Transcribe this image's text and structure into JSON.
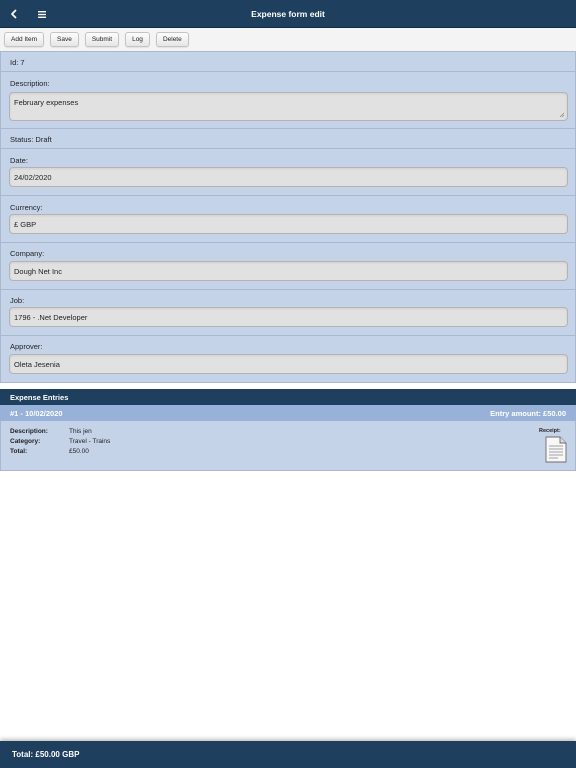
{
  "header": {
    "title": "Expense form edit",
    "back_icon": "chevron-left-icon",
    "menu_icon": "hamburger-menu-icon"
  },
  "toolbar": {
    "add_item": "Add Item",
    "save": "Save",
    "submit": "Submit",
    "log": "Log",
    "delete": "Delete"
  },
  "form": {
    "id_text": "Id: 7",
    "description_label": "Description:",
    "description_value": "February expenses",
    "status_text": "Status: Draft",
    "date_label": "Date:",
    "date_value": "24/02/2020",
    "currency_label": "Currency:",
    "currency_value": "£ GBP",
    "company_label": "Company:",
    "company_value": "Dough Net Inc",
    "job_label": "Job:",
    "job_value": "1796 - .Net Developer",
    "approver_label": "Approver:",
    "approver_value": "Oleta Jesenia"
  },
  "entries": {
    "heading": "Expense Entries",
    "items": [
      {
        "title": "#1 - 10/02/2020",
        "amount": "Entry amount: £50.00",
        "description_key": "Description:",
        "description_value": "This jen",
        "category_key": "Category:",
        "category_value": "Travel - Trains",
        "total_key": "Total:",
        "total_value": "£50.00",
        "receipt_label": "Receipt:",
        "receipt_icon": "document-icon"
      }
    ]
  },
  "footer": {
    "total": "Total: £50.00 GBP"
  },
  "colors": {
    "primary": "#1f3f5e",
    "form_bg": "#c5d3e9",
    "entry_bar": "#98b1d9",
    "field_bg": "#e1e1e1"
  }
}
